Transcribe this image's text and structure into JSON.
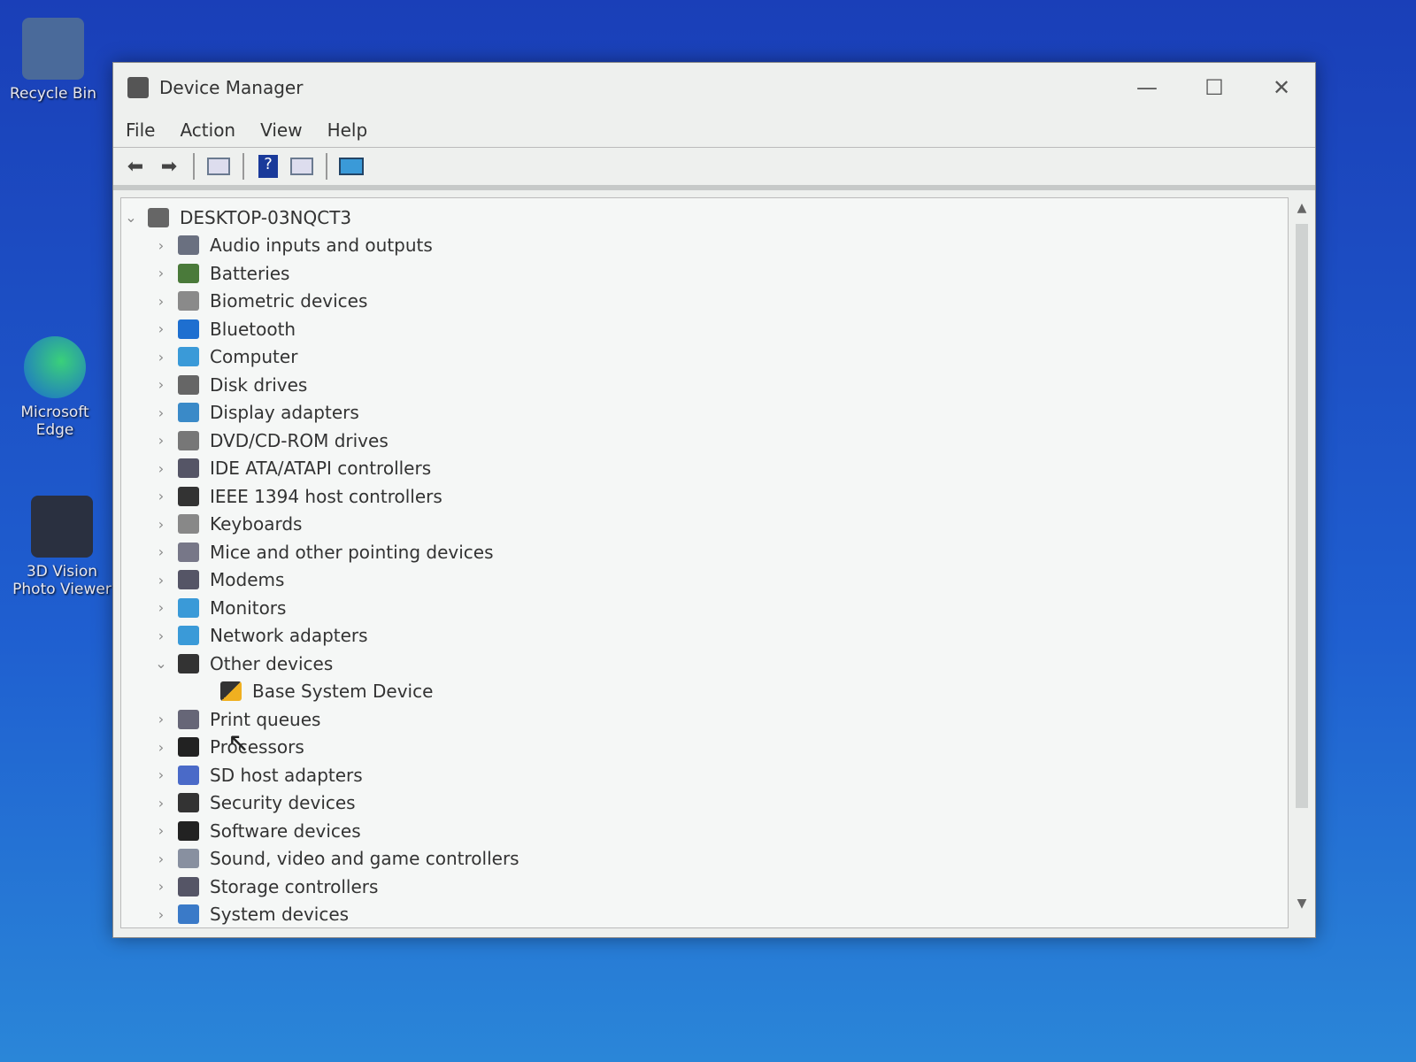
{
  "desktop": {
    "icons": [
      {
        "label": "Recycle Bin"
      },
      {
        "label": "Microsoft Edge"
      },
      {
        "label": "3D Vision Photo Viewer"
      }
    ]
  },
  "window": {
    "title": "Device Manager",
    "controls": {
      "minimize": "—",
      "maximize": "☐",
      "close": "✕"
    }
  },
  "menu": [
    "File",
    "Action",
    "View",
    "Help"
  ],
  "toolbar": {
    "icons": [
      "back-icon",
      "forward-icon",
      "show-hide-console-tree-icon",
      "help-icon",
      "properties-icon",
      "scan-hardware-icon"
    ]
  },
  "tree": {
    "root": "DESKTOP-03NQCT3",
    "items": [
      {
        "label": "Audio inputs and outputs",
        "color": "#6a7080"
      },
      {
        "label": "Batteries",
        "color": "#4a7a3a"
      },
      {
        "label": "Biometric devices",
        "color": "#8a8a8a"
      },
      {
        "label": "Bluetooth",
        "color": "#1e6fd0"
      },
      {
        "label": "Computer",
        "color": "#3a9ad8"
      },
      {
        "label": "Disk drives",
        "color": "#666"
      },
      {
        "label": "Display adapters",
        "color": "#3a8ac8"
      },
      {
        "label": "DVD/CD-ROM drives",
        "color": "#777"
      },
      {
        "label": "IDE ATA/ATAPI controllers",
        "color": "#556"
      },
      {
        "label": "IEEE 1394 host controllers",
        "color": "#333"
      },
      {
        "label": "Keyboards",
        "color": "#888"
      },
      {
        "label": "Mice and other pointing devices",
        "color": "#778"
      },
      {
        "label": "Modems",
        "color": "#556"
      },
      {
        "label": "Monitors",
        "color": "#3a9ad8"
      },
      {
        "label": "Network adapters",
        "color": "#3a9ad8"
      },
      {
        "label": "Other devices",
        "color": "#333",
        "expanded": true,
        "children": [
          {
            "label": "Base System Device",
            "warning": true
          }
        ]
      },
      {
        "label": "Print queues",
        "color": "#667"
      },
      {
        "label": "Processors",
        "color": "#222"
      },
      {
        "label": "SD host adapters",
        "color": "#4a6ac8"
      },
      {
        "label": "Security devices",
        "color": "#333"
      },
      {
        "label": "Software devices",
        "color": "#222"
      },
      {
        "label": "Sound, video and game controllers",
        "color": "#8890a0"
      },
      {
        "label": "Storage controllers",
        "color": "#556"
      },
      {
        "label": "System devices",
        "color": "#3a7ac8"
      }
    ]
  }
}
